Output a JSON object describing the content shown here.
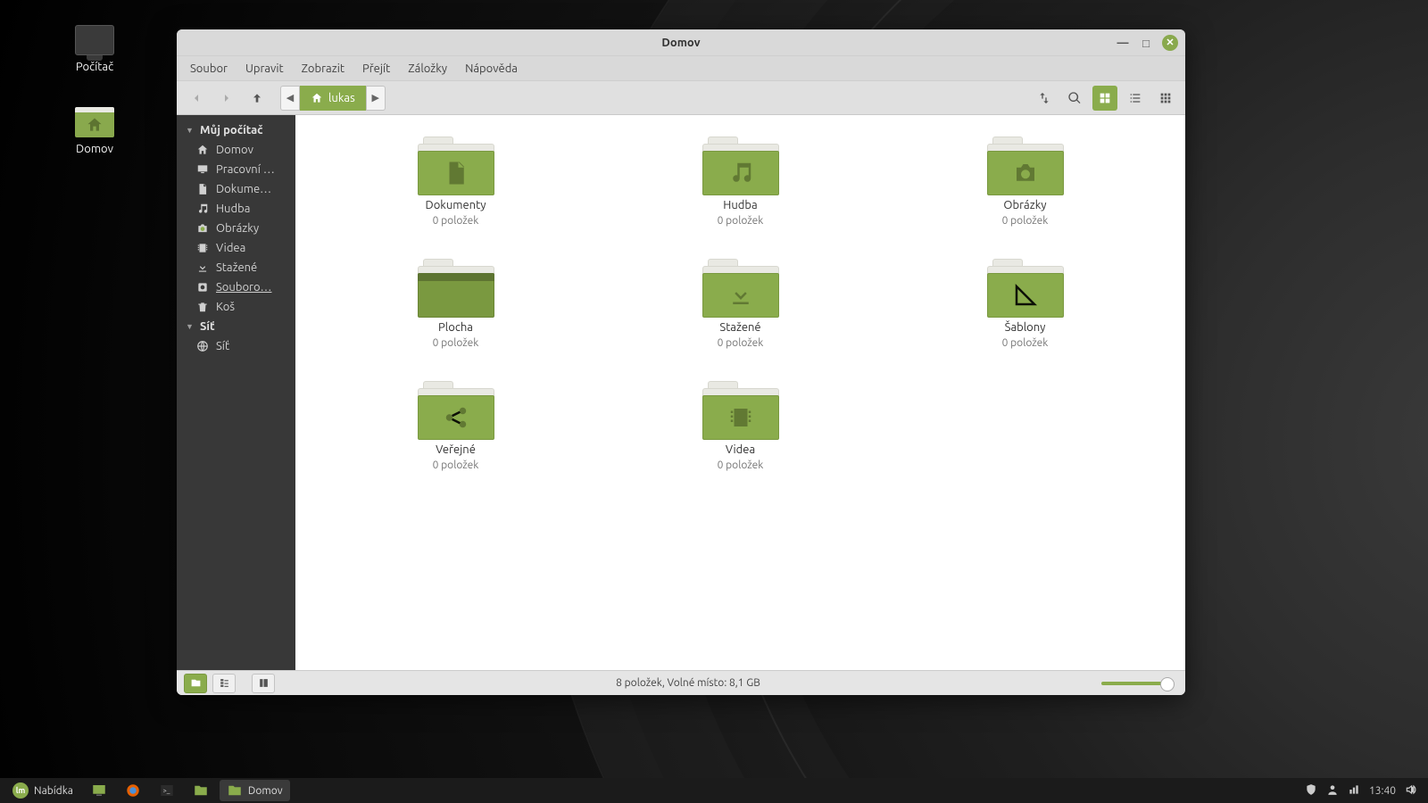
{
  "desktop": {
    "icons": [
      {
        "label": "Počítač",
        "kind": "computer"
      },
      {
        "label": "Domov",
        "kind": "home"
      }
    ]
  },
  "window": {
    "title": "Domov",
    "menu": [
      "Soubor",
      "Upravit",
      "Zobrazit",
      "Přejít",
      "Záložky",
      "Nápověda"
    ],
    "path_chip": "lukas",
    "sidebar": {
      "group1_label": "Můj počítač",
      "group1_items": [
        {
          "icon": "home",
          "label": "Domov"
        },
        {
          "icon": "desktop",
          "label": "Pracovní …"
        },
        {
          "icon": "doc",
          "label": "Dokume…"
        },
        {
          "icon": "music",
          "label": "Hudba"
        },
        {
          "icon": "camera",
          "label": "Obrázky"
        },
        {
          "icon": "video",
          "label": "Videa"
        },
        {
          "icon": "download",
          "label": "Stažené"
        },
        {
          "icon": "disk",
          "label": "Souboro…",
          "underline": true
        },
        {
          "icon": "trash",
          "label": "Koš"
        }
      ],
      "group2_label": "Síť",
      "group2_items": [
        {
          "icon": "globe",
          "label": "Síť"
        }
      ]
    },
    "folders": [
      {
        "name": "Dokumenty",
        "sub": "0 položek",
        "icon": "doc"
      },
      {
        "name": "Hudba",
        "sub": "0 položek",
        "icon": "music"
      },
      {
        "name": "Obrázky",
        "sub": "0 položek",
        "icon": "camera"
      },
      {
        "name": "Plocha",
        "sub": "0 položek",
        "icon": "desktop"
      },
      {
        "name": "Stažené",
        "sub": "0 položek",
        "icon": "download"
      },
      {
        "name": "Šablony",
        "sub": "0 položek",
        "icon": "template"
      },
      {
        "name": "Veřejné",
        "sub": "0 položek",
        "icon": "share"
      },
      {
        "name": "Videa",
        "sub": "0 položek",
        "icon": "video"
      }
    ],
    "status": "8 položek, Volné místo: 8,1 GB"
  },
  "taskbar": {
    "menu_label": "Nabídka",
    "window_label": "Domov",
    "clock": "13:40"
  }
}
